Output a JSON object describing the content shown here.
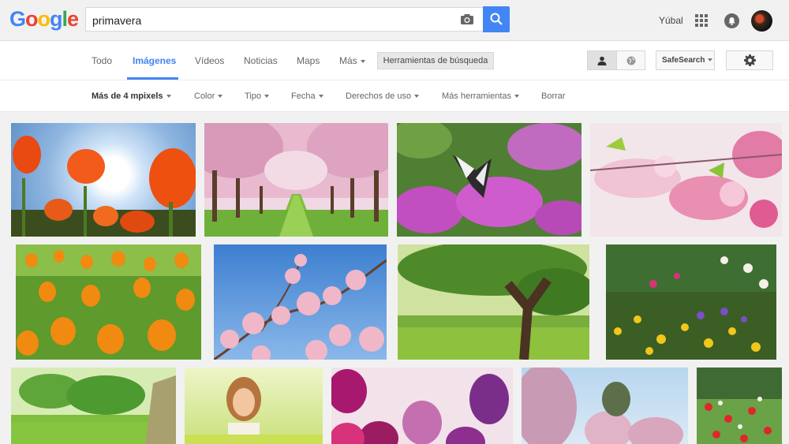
{
  "header": {
    "logo": [
      "G",
      "o",
      "o",
      "g",
      "l",
      "e"
    ],
    "logo_colors": [
      "#4285f4",
      "#ea4335",
      "#fbbc05",
      "#4285f4",
      "#34a853",
      "#ea4335"
    ],
    "search_value": "primavera",
    "user_name": "Yúbal"
  },
  "nav": {
    "tabs": [
      {
        "label": "Todo"
      },
      {
        "label": "Imágenes",
        "active": true
      },
      {
        "label": "Vídeos"
      },
      {
        "label": "Noticias"
      },
      {
        "label": "Maps"
      },
      {
        "label": "Más"
      }
    ],
    "tools_button": "Herramientas de búsqueda",
    "safesearch": "SafeSearch"
  },
  "tools": [
    {
      "label": "Más de 4 mpixels",
      "active": true
    },
    {
      "label": "Color"
    },
    {
      "label": "Tipo"
    },
    {
      "label": "Fecha"
    },
    {
      "label": "Derechos de uso"
    },
    {
      "label": "Más herramientas"
    },
    {
      "label": "Borrar"
    }
  ],
  "accent_color": "#4285f4",
  "results": [
    {
      "subject": "tulips-sun"
    },
    {
      "subject": "cherry-avenue"
    },
    {
      "subject": "butterfly-flowers"
    },
    {
      "subject": "pink-blossom-macro"
    },
    {
      "subject": "tulip-field"
    },
    {
      "subject": "blossom-sky"
    },
    {
      "subject": "tree-sunlight"
    },
    {
      "subject": "flower-garden"
    },
    {
      "subject": "park-trees"
    },
    {
      "subject": "woman-meadow"
    },
    {
      "subject": "purple-tulips"
    },
    {
      "subject": "blossom-town"
    },
    {
      "subject": "red-flowers-field"
    }
  ]
}
